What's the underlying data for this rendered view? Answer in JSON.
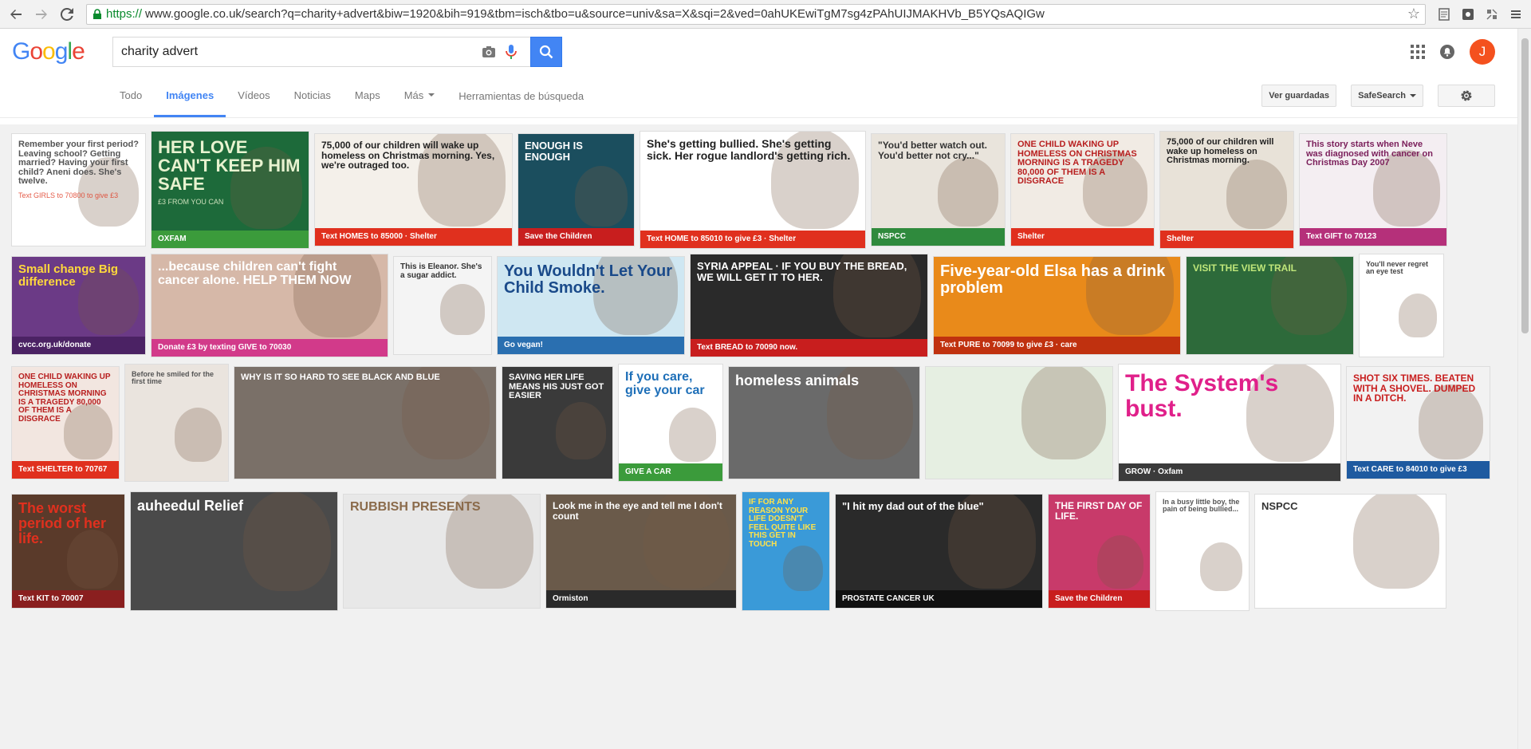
{
  "browser": {
    "url_scheme": "https://",
    "url_rest": "www.google.co.uk/search?q=charity+advert&biw=1920&bih=919&tbm=isch&tbo=u&source=univ&sa=X&sqi=2&ved=0ahUKEwiTgM7sg4zPAhUIJMAKHVb_B5YQsAQIGw"
  },
  "header": {
    "logo": [
      "G",
      "o",
      "o",
      "g",
      "l",
      "e"
    ],
    "search_value": "charity advert",
    "avatar_letter": "J"
  },
  "tabs": [
    {
      "label": "Todo",
      "active": false
    },
    {
      "label": "Imágenes",
      "active": true
    },
    {
      "label": "Vídeos",
      "active": false
    },
    {
      "label": "Noticias",
      "active": false
    },
    {
      "label": "Maps",
      "active": false
    },
    {
      "label": "Más",
      "active": false,
      "dropdown": true
    }
  ],
  "tools_label": "Herramientas de búsqueda",
  "right_buttons": {
    "saved": "Ver guardadas",
    "safesearch": "SafeSearch"
  },
  "rows": [
    [
      {
        "w": 169,
        "title": "Remember your first period? Leaving school? Getting married? Having your first child? Aneni does. She's twelve.",
        "bg": "#ffffff",
        "fg": "#555",
        "accent": "#e0402a",
        "sub": "Text GIRLS to 70800 to give £3",
        "fs": 11
      },
      {
        "w": 199,
        "title": "HER LOVE CAN'T KEEP HIM SAFE",
        "bg": "#1d6a3a",
        "fg": "#e8f3d0",
        "sub": "£3 FROM YOU CAN",
        "fs": 22,
        "strip": "OXFAM",
        "stripbg": "#3b9b3b"
      },
      {
        "w": 249,
        "title": "75,000 of our children will wake up homeless on Christmas morning. Yes, we're outraged too.",
        "bg": "#f4f0ea",
        "fg": "#222",
        "fs": 12,
        "strip": "Text HOMES to 85000 · Shelter",
        "stripbg": "#e0301e"
      },
      {
        "w": 147,
        "title": "ENOUGH IS ENOUGH",
        "bg": "#1b4e5e",
        "fg": "#ffffff",
        "fs": 13,
        "strip": "Save the Children",
        "stripbg": "#c81e1e"
      },
      {
        "w": 284,
        "title": "She's getting bullied. She's getting sick. Her rogue landlord's getting rich.",
        "bg": "#ffffff",
        "fg": "#222",
        "accent": "#e0301e",
        "fs": 14,
        "strip": "Text HOME to 85010 to give £3 · Shelter",
        "stripbg": "#e0301e"
      },
      {
        "w": 169,
        "title": "\"You'd better watch out. You'd better not cry...\"",
        "bg": "#e9e4dc",
        "fg": "#333",
        "fs": 12,
        "strip": "NSPCC",
        "stripbg": "#2f8a3d"
      },
      {
        "w": 181,
        "title": "ONE CHILD WAKING UP HOMELESS ON CHRISTMAS MORNING IS A TRAGEDY 80,000 OF THEM IS A DISGRACE",
        "bg": "#f1ebe4",
        "fg": "#b81f1f",
        "fs": 11,
        "strip": "Shelter",
        "stripbg": "#e0301e"
      },
      {
        "w": 169,
        "title": "75,000 of our children will wake up homeless on Christmas morning.",
        "bg": "#e8e2d8",
        "fg": "#222",
        "fs": 11,
        "strip": "Shelter",
        "stripbg": "#e0301e"
      },
      {
        "w": 186,
        "title": "This story starts when Neve was diagnosed with cancer on Christmas Day 2007",
        "bg": "#f4eef2",
        "fg": "#7a1e5a",
        "fs": 11,
        "strip": "Text GIFT to 70123",
        "stripbg": "#b5307a"
      }
    ],
    [
      {
        "w": 169,
        "title": "Small change Big difference",
        "bg": "#6b3a86",
        "fg": "#ffd83d",
        "fs": 15,
        "strip": "cvcc.org.uk/donate",
        "stripbg": "#4b2264"
      },
      {
        "w": 298,
        "title": "...because children can't fight cancer alone. HELP THEM NOW",
        "bg": "#d6b8a8",
        "fg": "#ffffff",
        "fs": 16,
        "strip": "Donate £3 by texting GIVE to 70030",
        "stripbg": "#d23a8a"
      },
      {
        "w": 124,
        "title": "This is Eleanor. She's a sugar addict.",
        "bg": "#f4f4f4",
        "fg": "#333",
        "fs": 10
      },
      {
        "w": 236,
        "title": "You Wouldn't Let Your Child Smoke.",
        "bg": "#cfe7f2",
        "fg": "#1a4a8a",
        "fs": 20,
        "strip": "Go vegan!",
        "stripbg": "#2a6fb0"
      },
      {
        "w": 299,
        "title": "SYRIA APPEAL · IF YOU BUY THE BREAD, WE WILL GET IT TO HER.",
        "bg": "#2a2a2a",
        "fg": "#ffffff",
        "fs": 13,
        "strip": "Text BREAD to 70090 now.",
        "stripbg": "#c81e1e"
      },
      {
        "w": 311,
        "title": "Five-year-old Elsa has a drink problem",
        "bg": "#e98a1a",
        "fg": "#ffffff",
        "fs": 20,
        "strip": "Text PURE to 70099 to give £3 · care",
        "stripbg": "#c0310f"
      },
      {
        "w": 211,
        "title": "VISIT THE VIEW TRAIL",
        "bg": "#2d6a3a",
        "fg": "#bfe67a",
        "fs": 12
      },
      {
        "w": 107,
        "title": "You'll never regret an eye test",
        "bg": "#ffffff",
        "fg": "#444",
        "fs": 9
      }
    ],
    [
      {
        "w": 136,
        "title": "ONE CHILD WAKING UP HOMELESS ON CHRISTMAS MORNING IS A TRAGEDY 80,000 OF THEM IS A DISGRACE",
        "bg": "#f2e6e0",
        "fg": "#b81f1f",
        "fs": 10,
        "strip": "Text SHELTER to 70767",
        "stripbg": "#e0301e"
      },
      {
        "w": 131,
        "title": "Before he smiled for the first time",
        "bg": "#eae4de",
        "fg": "#555",
        "fs": 9
      },
      {
        "w": 330,
        "title": "WHY IS IT SO HARD TO SEE BLACK AND BLUE",
        "bg": "#7a7068",
        "fg": "#ffffff",
        "fs": 11
      },
      {
        "w": 140,
        "title": "SAVING HER LIFE MEANS HIS JUST GOT EASIER",
        "bg": "#3a3a3a",
        "fg": "#ffffff",
        "fs": 11
      },
      {
        "w": 132,
        "title": "If you care, give your car",
        "bg": "#ffffff",
        "fg": "#1e6fb8",
        "fs": 16,
        "strip": "GIVE A CAR",
        "stripbg": "#3b9b3b"
      },
      {
        "w": 241,
        "title": "homeless animals",
        "bg": "#6a6a6a",
        "fg": "#ffffff",
        "fs": 18
      },
      {
        "w": 236,
        "title": "",
        "bg": "#e6efe2",
        "fg": "#333",
        "fs": 10
      },
      {
        "w": 280,
        "title": "The System's bust.",
        "bg": "#ffffff",
        "fg": "#e0208a",
        "fs": 30,
        "strip": "GROW · Oxfam",
        "stripbg": "#3b3b3b"
      },
      {
        "w": 181,
        "title": "SHOT SIX TIMES. BEATEN WITH A SHOVEL. DUMPED IN A DITCH.",
        "bg": "#f2f2f2",
        "fg": "#c81e1e",
        "fs": 12,
        "strip": "Text CARE to 84010 to give £3",
        "stripbg": "#1e5aa0"
      }
    ],
    [
      {
        "w": 143,
        "title": "The worst period of her life.",
        "bg": "#5a3a2a",
        "fg": "#e0301e",
        "fs": 18,
        "strip": "Text KIT to 70007",
        "stripbg": "#8a1f1f"
      },
      {
        "w": 261,
        "title": "auheedul Relief",
        "bg": "#4a4a4a",
        "fg": "#ffffff",
        "fs": 18
      },
      {
        "w": 248,
        "title": "RUBBISH PRESENTS",
        "bg": "#e8e8e8",
        "fg": "#8a6a4a",
        "fs": 16
      },
      {
        "w": 240,
        "title": "Look me in the eye and tell me I don't count",
        "bg": "#6a5a4a",
        "fg": "#ffffff",
        "fs": 12,
        "strip": "Ormiston",
        "stripbg": "#2a2a2a"
      },
      {
        "w": 111,
        "title": "IF FOR ANY REASON YOUR LIFE DOESN'T FEEL QUITE LIKE THIS GET IN TOUCH",
        "bg": "#3a9ad8",
        "fg": "#ffe24a",
        "fs": 10
      },
      {
        "w": 261,
        "title": "\"I hit my dad out of the blue\"",
        "bg": "#2a2a2a",
        "fg": "#ffffff",
        "fs": 13,
        "strip": "PROSTATE CANCER UK",
        "stripbg": "#111111"
      },
      {
        "w": 129,
        "title": "THE FIRST DAY OF LIFE.",
        "bg": "#c83a6a",
        "fg": "#ffffff",
        "fs": 12,
        "strip": "Save the Children",
        "stripbg": "#c81e1e"
      },
      {
        "w": 118,
        "title": "In a busy little boy, the pain of being bullied...",
        "bg": "#ffffff",
        "fg": "#555",
        "fs": 9
      },
      {
        "w": 241,
        "title": "NSPCC",
        "bg": "#ffffff",
        "fg": "#333",
        "fs": 13
      }
    ]
  ]
}
